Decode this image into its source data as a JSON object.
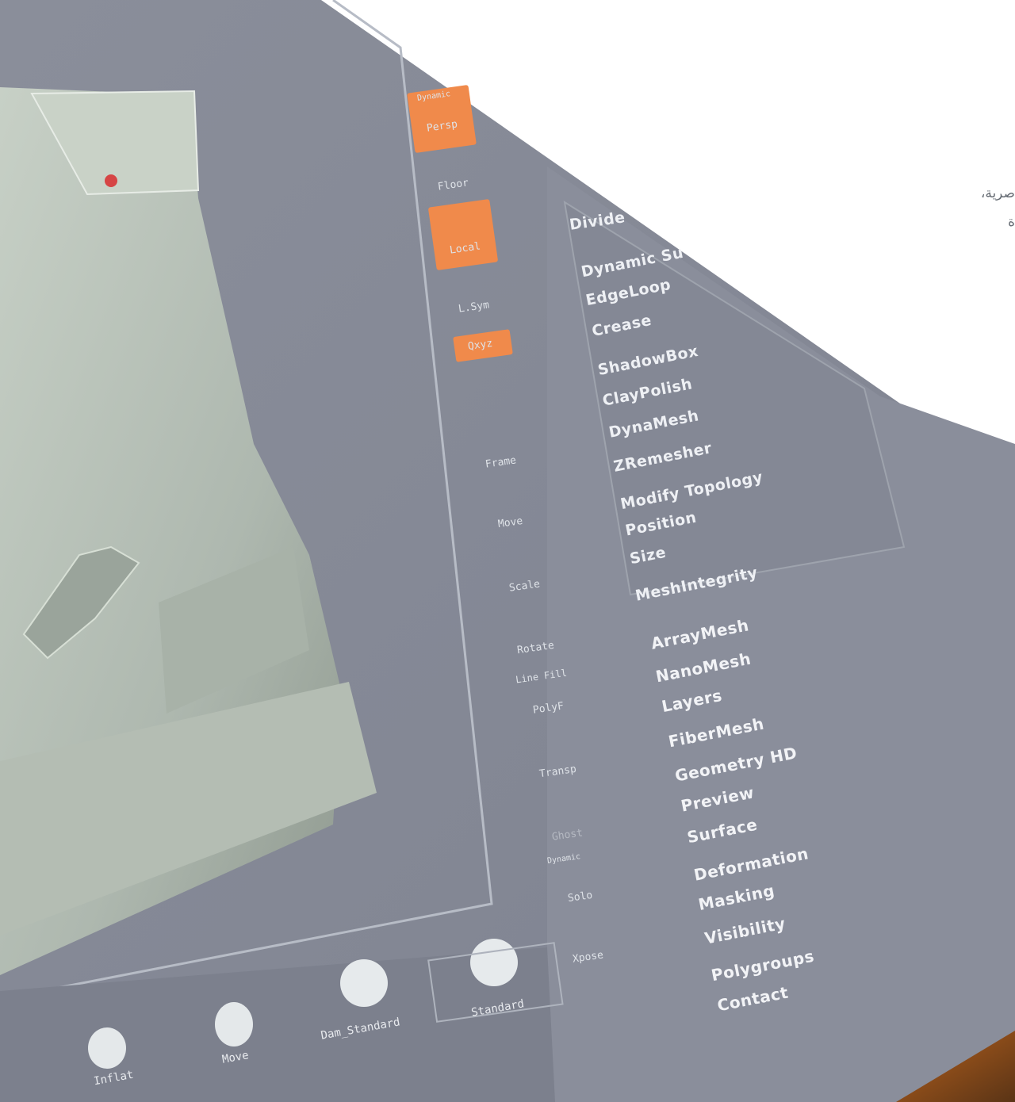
{
  "caption": {
    "line1": "صرية،",
    "line2": "ة"
  },
  "toolbar": {
    "items": [
      {
        "label": "Dynamic",
        "icon": "perspective-icon"
      },
      {
        "label": "Persp",
        "icon": "perspective-icon"
      },
      {
        "label": "Floor",
        "icon": "floor-icon"
      },
      {
        "label": "Local",
        "icon": "local-icon"
      },
      {
        "label": "L.Sym",
        "icon": "symmetry-icon"
      },
      {
        "label": "Qxyz",
        "icon": "axis-icon"
      },
      {
        "label": "Frame",
        "icon": "frame-icon"
      },
      {
        "label": "Move",
        "icon": "move-hand-icon"
      },
      {
        "label": "Scale",
        "icon": "scale-icon"
      },
      {
        "label": "Rotate",
        "icon": "rotate-icon"
      },
      {
        "label": "Line Fill",
        "icon": "linefill-icon"
      },
      {
        "label": "PolyF",
        "icon": "polyframe-icon"
      },
      {
        "label": "Transp",
        "icon": "transparency-icon"
      },
      {
        "label": "Ghost",
        "icon": "ghost-icon"
      },
      {
        "label": "Dynamic",
        "icon": "solo-icon"
      },
      {
        "label": "Solo",
        "icon": "solo-icon"
      },
      {
        "label": "Xpose",
        "icon": "xpose-icon"
      }
    ]
  },
  "geometry_menu": {
    "divide": "Divide",
    "items": [
      "Dynamic Su",
      "EdgeLoop",
      "Crease",
      "ShadowBox",
      "ClayPolish",
      "DynaMesh",
      "ZRemesher",
      "Modify Topology",
      "Position",
      "Size",
      "MeshIntegrity"
    ]
  },
  "tool_menu": {
    "items": [
      "ArrayMesh",
      "NanoMesh",
      "Layers",
      "FiberMesh",
      "Geometry HD",
      "Preview",
      "Surface",
      "Deformation",
      "Masking",
      "Visibility",
      "Polygroups",
      "Contact"
    ]
  },
  "brushes": {
    "items": [
      "Inflat",
      "Move",
      "Dam_Standard",
      "Standard"
    ]
  },
  "colors": {
    "screen_bg": "#8c909c",
    "panel_bg": "#838794",
    "model_color": "#bcc6bd",
    "accent_orange": "#f08a4b",
    "text_light": "#eef0f4"
  }
}
